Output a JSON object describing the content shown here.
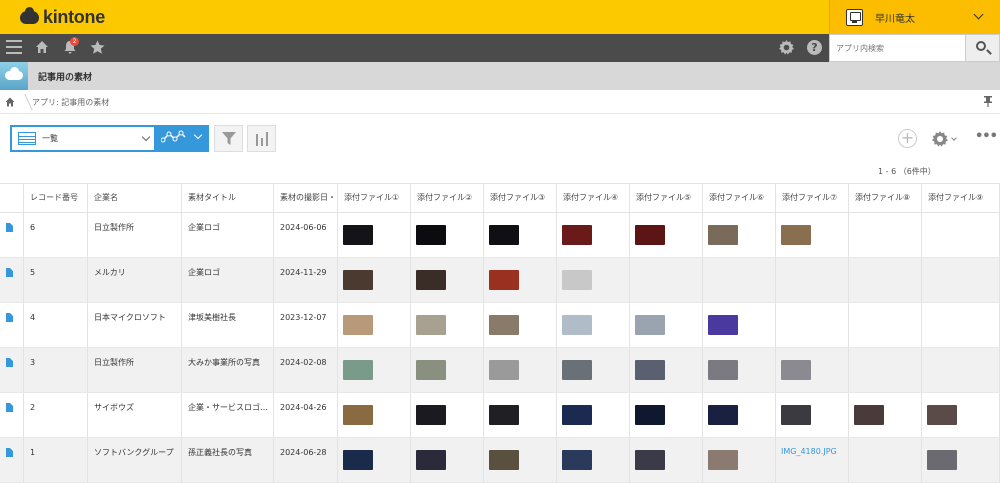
{
  "header": {
    "brand": "kintone",
    "user_name": "早川竜太",
    "notification_count": "2"
  },
  "search": {
    "placeholder": "アプリ内検索"
  },
  "app": {
    "title": "記事用の素材"
  },
  "breadcrumb": {
    "text": "アプリ: 記事用の素材"
  },
  "view": {
    "selected": "一覧"
  },
  "pager": {
    "text": "1 - 6 （6件中）"
  },
  "table": {
    "columns": [
      "レコード番号",
      "企業名",
      "素材タイトル",
      "素材の撮影日・",
      "添付ファイル①",
      "添付ファイル②",
      "添付ファイル③",
      "添付ファイル④",
      "添付ファイル⑤",
      "添付ファイル⑥",
      "添付ファイル⑦",
      "添付ファイル⑧",
      "添付ファイル⑨"
    ],
    "rows": [
      {
        "id": "6",
        "company": "日立製作所",
        "title": "企業ロゴ",
        "date": "2024-06-06",
        "files": [
          "#141418",
          "#0c0c10",
          "#101014",
          "#6b1a1a",
          "#5c1414",
          "#7a6a5a",
          "#8a6e50",
          null,
          null
        ]
      },
      {
        "id": "5",
        "company": "メルカリ",
        "title": "企業ロゴ",
        "date": "2024-11-29",
        "files": [
          "#4a3a30",
          "#3a2c26",
          "#9a3020",
          "#c8c8c8",
          null,
          null,
          null,
          null,
          null
        ]
      },
      {
        "id": "4",
        "company": "日本マイクロソフト",
        "title": "津坂美樹社長",
        "date": "2023-12-07",
        "files": [
          "#b89a7a",
          "#a8a090",
          "#8a7a6a",
          "#b0bcc8",
          "#9aa4b0",
          "#4a3aa0",
          null,
          null,
          null
        ]
      },
      {
        "id": "3",
        "company": "日立製作所",
        "title": "大みか事業所の写真",
        "date": "2024-02-08",
        "files": [
          "#7a9a8a",
          "#8a9080",
          "#9a9a9a",
          "#6a7078",
          "#5a6070",
          "#7a7a80",
          "#8a8a90",
          null,
          null
        ]
      },
      {
        "id": "2",
        "company": "サイボウズ",
        "title": "企業・サービスロゴ…",
        "date": "2024-04-26",
        "files": [
          "#8a6a40",
          "#1a1a20",
          "#202024",
          "#1a2a50",
          "#101830",
          "#1a2040",
          "#3a3a40",
          "#4a3a3a",
          "#5a4a48"
        ]
      },
      {
        "id": "1",
        "company": "ソフトバンクグループ",
        "title": "孫正義社長の写真",
        "date": "2024-06-28",
        "files": [
          "#1a2a4a",
          "#2a2a3a",
          "#5a5040",
          "#2a3a5a",
          "#3a3a48",
          "#8a7a70",
          "IMG_4180.JPG",
          null,
          "#6a6a70"
        ]
      }
    ]
  }
}
